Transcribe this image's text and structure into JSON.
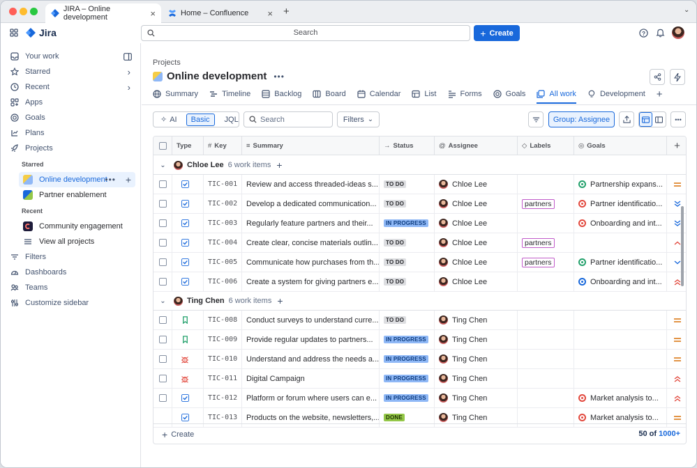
{
  "browser": {
    "tabs": [
      {
        "title": "JIRA – Online development",
        "active": true
      },
      {
        "title": "Home – Confluence",
        "active": false
      }
    ]
  },
  "topbar": {
    "app_name": "Jira",
    "search_placeholder": "Search",
    "create_label": "Create"
  },
  "sidebar": {
    "items": [
      {
        "label": "Your work",
        "icon": "inbox-icon"
      },
      {
        "label": "Starred",
        "icon": "star-icon"
      },
      {
        "label": "Recent",
        "icon": "clock-icon"
      },
      {
        "label": "Apps",
        "icon": "apps-icon"
      },
      {
        "label": "Goals",
        "icon": "target-icon"
      },
      {
        "label": "Plans",
        "icon": "plans-icon"
      },
      {
        "label": "Projects",
        "icon": "rocket-icon"
      }
    ],
    "starred_heading": "Starred",
    "starred": [
      {
        "label": "Online development"
      },
      {
        "label": "Partner enablement"
      }
    ],
    "recent_heading": "Recent",
    "recent": [
      {
        "label": "Community engagement"
      },
      {
        "label": "View all projects"
      }
    ],
    "bottom_items": [
      {
        "label": "Filters"
      },
      {
        "label": "Dashboards"
      },
      {
        "label": "Teams"
      },
      {
        "label": "Customize sidebar"
      }
    ]
  },
  "project": {
    "breadcrumb": "Projects",
    "title": "Online development",
    "tabs": [
      "Summary",
      "Timeline",
      "Backlog",
      "Board",
      "Calendar",
      "List",
      "Forms",
      "Goals",
      "All work",
      "Development"
    ],
    "active_tab": "All work"
  },
  "toolbar": {
    "ai": "AI",
    "basic": "Basic",
    "jql": "JQL",
    "search_placeholder": "Search",
    "filters": "Filters",
    "group": "Group: Assignee"
  },
  "table": {
    "columns": [
      "Type",
      "Key",
      "Summary",
      "Status",
      "Assignee",
      "Labels",
      "Goals"
    ],
    "groups": [
      {
        "name": "Chloe Lee",
        "count": "6 work items",
        "rows": [
          {
            "type": "task",
            "key": "TIC-001",
            "summary": "Review and access threaded-ideas s...",
            "status": "TO DO",
            "assignee": "Chloe Lee",
            "label": "",
            "goal": "Partnership expans...",
            "goal_color": "#22a06b",
            "priority": "medium"
          },
          {
            "type": "task",
            "key": "TIC-002",
            "summary": "Develop a dedicated communication...",
            "status": "TO DO",
            "assignee": "Chloe Lee",
            "label": "partners",
            "goal": "Partner identificatio...",
            "goal_color": "#e2483d",
            "priority": "lowest"
          },
          {
            "type": "task",
            "key": "TIC-003",
            "summary": "Regularly feature partners and their...",
            "status": "IN PROGRESS",
            "assignee": "Chloe Lee",
            "label": "",
            "goal": "Onboarding and int...",
            "goal_color": "#e2483d",
            "priority": "lowest"
          },
          {
            "type": "task",
            "key": "TIC-004",
            "summary": "Create clear, concise materials outlin...",
            "status": "TO DO",
            "assignee": "Chloe Lee",
            "label": "partners",
            "goal": "",
            "goal_color": "",
            "priority": "high"
          },
          {
            "type": "task",
            "key": "TIC-005",
            "summary": "Communicate how purchases from th...",
            "status": "TO DO",
            "assignee": "Chloe Lee",
            "label": "partners",
            "goal": "Partner identificatio...",
            "goal_color": "#22a06b",
            "priority": "low"
          },
          {
            "type": "task",
            "key": "TIC-006",
            "summary": "Create a system for giving partners e...",
            "status": "TO DO",
            "assignee": "Chloe Lee",
            "label": "",
            "goal": "Onboarding and int...",
            "goal_color": "#1868db",
            "priority": "highest"
          }
        ]
      },
      {
        "name": "Ting Chen",
        "count": "6 work items",
        "rows": [
          {
            "type": "story",
            "key": "TIC-008",
            "summary": "Conduct surveys to understand curre...",
            "status": "TO DO",
            "assignee": "Ting Chen",
            "label": "",
            "goal": "",
            "goal_color": "",
            "priority": "medium"
          },
          {
            "type": "story",
            "key": "TIC-009",
            "summary": "Provide regular updates to partners...",
            "status": "IN PROGRESS",
            "assignee": "Ting Chen",
            "label": "",
            "goal": "",
            "goal_color": "",
            "priority": "medium"
          },
          {
            "type": "bug",
            "key": "TIC-010",
            "summary": "Understand and address the needs a...",
            "status": "IN PROGRESS",
            "assignee": "Ting Chen",
            "label": "",
            "goal": "",
            "goal_color": "",
            "priority": "medium"
          },
          {
            "type": "bug",
            "key": "TIC-011",
            "summary": "Digital Campaign",
            "status": "IN PROGRESS",
            "assignee": "Ting Chen",
            "label": "",
            "goal": "",
            "goal_color": "",
            "priority": "highest"
          },
          {
            "type": "task",
            "key": "TIC-012",
            "summary": "Platform or forum where users can e...",
            "status": "IN PROGRESS",
            "assignee": "Ting Chen",
            "label": "",
            "goal": "Market analysis to...",
            "goal_color": "#e2483d",
            "priority": "highest"
          },
          {
            "type": "task",
            "key": "TIC-013",
            "summary": "Products on the website, newsletters,...",
            "status": "DONE",
            "assignee": "Ting Chen",
            "label": "",
            "goal": "Market analysis to...",
            "goal_color": "#e2483d",
            "priority": "medium"
          }
        ]
      }
    ],
    "footer_create": "Create",
    "footer_count_a": "50 of",
    "footer_count_b": "1000+"
  }
}
